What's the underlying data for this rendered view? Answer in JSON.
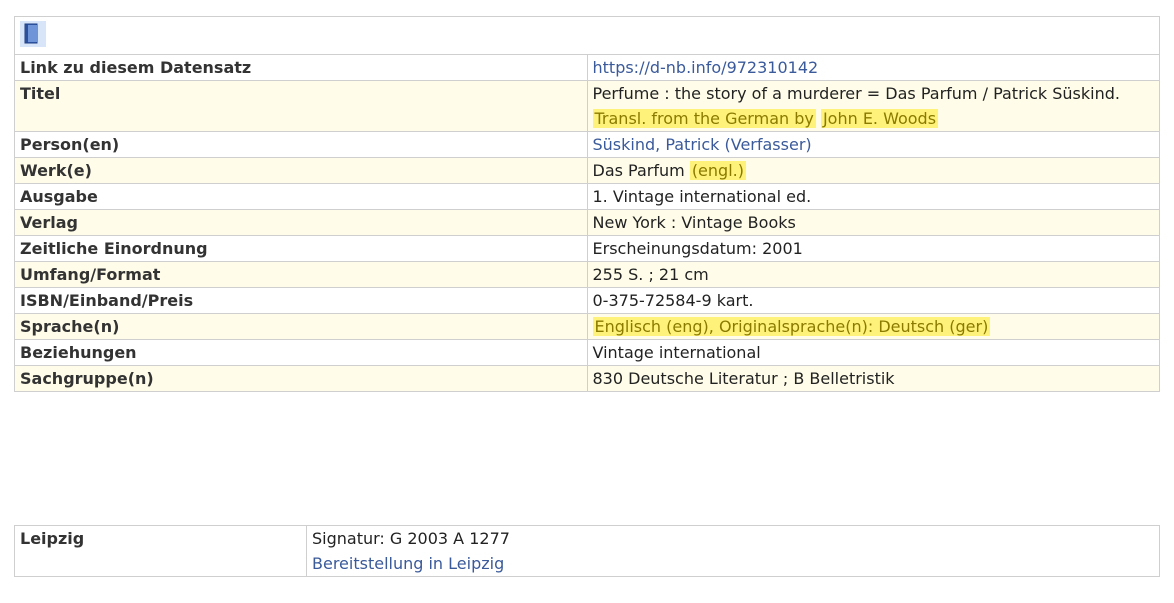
{
  "record": {
    "icon": "book-icon",
    "link_label": "Link zu diesem Datensatz",
    "link_value": "https://d-nb.info/972310142",
    "title_label": "Titel",
    "title_main": "Perfume : the story of a murderer = Das Parfum / Patrick Süskind.",
    "title_highlight_1": "Transl. from the German by",
    "title_highlight_2": "John E. Woods",
    "person_label": "Person(en)",
    "person_value": "Süskind, Patrick (Verfasser)",
    "work_label": "Werk(e)",
    "work_value": "Das Parfum",
    "work_highlight": "(engl.)",
    "edition_label": "Ausgabe",
    "edition_value": "1. Vintage international ed.",
    "publisher_label": "Verlag",
    "publisher_value": "New York : Vintage Books",
    "date_label": "Zeitliche Einordnung",
    "date_value": "Erscheinungsdatum: 2001",
    "extent_label": "Umfang/Format",
    "extent_value": "255 S. ; 21 cm",
    "isbn_label": "ISBN/Einband/Preis",
    "isbn_value": "0-375-72584-9 kart.",
    "language_label": "Sprache(n)",
    "language_value": "Englisch (eng), Originalsprache(n): Deutsch (ger)",
    "relations_label": "Beziehungen",
    "relations_value": "Vintage international",
    "subject_label": "Sachgruppe(n)",
    "subject_value": "830 Deutsche Literatur ; B Belletristik"
  },
  "holdings": {
    "location_label": "Leipzig",
    "signature": "Signatur: G 2003 A 1277",
    "provision_link": "Bereitstellung in Leipzig"
  },
  "colors": {
    "link": "#3a5a9a",
    "highlight_bg": "#fff27a",
    "row_shade": "#fffde9"
  }
}
